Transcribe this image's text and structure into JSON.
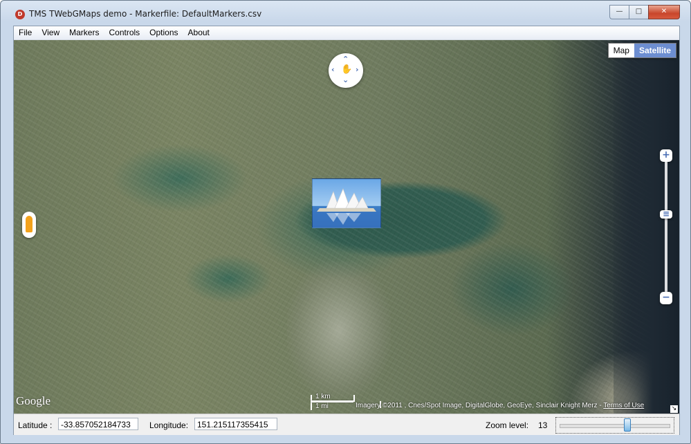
{
  "window": {
    "title": "TMS TWebGMaps demo - Markerfile: DefaultMarkers.csv",
    "icon_label": "D",
    "minimize_icon": "minimize-icon",
    "maximize_icon": "maximize-icon",
    "close_icon": "close-icon"
  },
  "menu": {
    "items": [
      {
        "label": "File"
      },
      {
        "label": "View"
      },
      {
        "label": "Markers"
      },
      {
        "label": "Controls"
      },
      {
        "label": "Options"
      },
      {
        "label": "About"
      }
    ]
  },
  "map": {
    "type_buttons": [
      {
        "label": "Map",
        "active": false
      },
      {
        "label": "Satellite",
        "active": true
      }
    ],
    "google_logo": "Google",
    "scale_km": "1 km",
    "scale_mi": "1 mi",
    "attribution": "Imagery ©2011 , Cnes/Spot Image, DigitalGlobe, GeoEye, Sinclair Knight Merz - ",
    "terms_link": "Terms of Use",
    "zoom_in_label": "+",
    "zoom_out_label": "−",
    "marker_icon": "opera-house-marker-icon"
  },
  "status": {
    "latitude_label": "Latitude :",
    "latitude_value": "-33.857052184733",
    "longitude_label": "Longitude:",
    "longitude_value": "151.215117355415",
    "zoom_label": "Zoom level:",
    "zoom_value": "13",
    "zoom_slider_position": 0.62
  },
  "colors": {
    "active_maptype": "#6d8ed1",
    "control_blue": "#4b6fb5",
    "pegman_orange": "#f3a21c"
  }
}
